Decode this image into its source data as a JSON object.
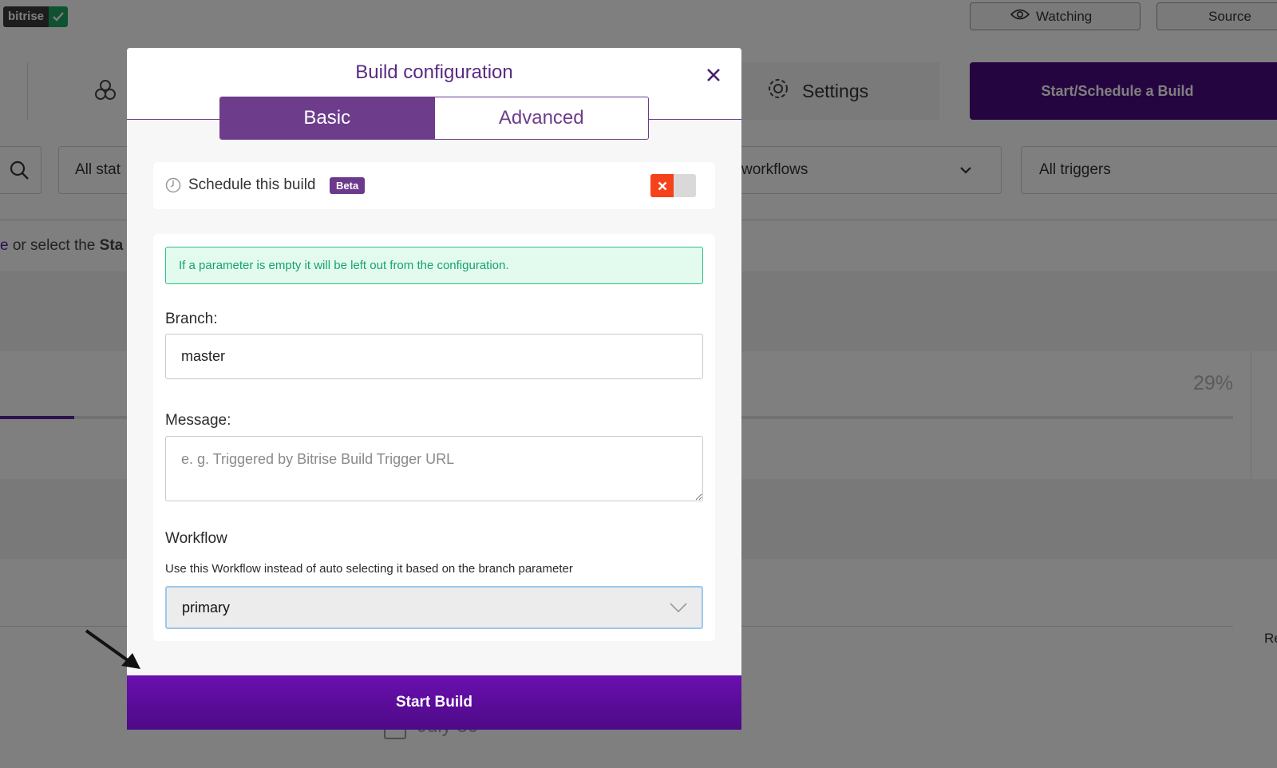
{
  "background": {
    "logo_text": "bitrise",
    "watching_label": "Watching",
    "source_label": "Source",
    "settings_label": "Settings",
    "start_schedule_label": "Start/Schedule a Build",
    "status_filter": "All stat",
    "workflows_filter": "workflows",
    "triggers_filter": "All triggers",
    "hint_prefix": "e",
    "hint_text": " or select the ",
    "hint_bold": "Sta",
    "progress_percent": "29%",
    "progress_value": 0.06,
    "side_text": "Re",
    "date_text": "July 30"
  },
  "modal": {
    "title": "Build configuration",
    "tabs": [
      {
        "label": "Basic",
        "active": true
      },
      {
        "label": "Advanced",
        "active": false
      }
    ],
    "schedule": {
      "label": "Schedule this build",
      "badge": "Beta",
      "enabled": false
    },
    "info_message": "If a parameter is empty it will be left out from the configuration.",
    "branch": {
      "label": "Branch:",
      "value": "master"
    },
    "message": {
      "label": "Message:",
      "placeholder": "e. g. Triggered by Bitrise Build Trigger URL",
      "value": ""
    },
    "workflow": {
      "label": "Workflow",
      "description": "Use this Workflow instead of auto selecting it based on the branch parameter",
      "selected": "primary"
    },
    "submit_label": "Start Build"
  },
  "colors": {
    "brand_purple": "#6d3d8c",
    "button_purple": "#5b0c9a",
    "info_green": "#17a36b",
    "toggle_off_red": "#f5421a"
  },
  "icons": [
    "close-icon",
    "clock-icon",
    "x-icon",
    "chevron-down-icon",
    "eye-icon",
    "gear-icon",
    "search-icon",
    "hexagons-icon",
    "arrow-icon"
  ]
}
